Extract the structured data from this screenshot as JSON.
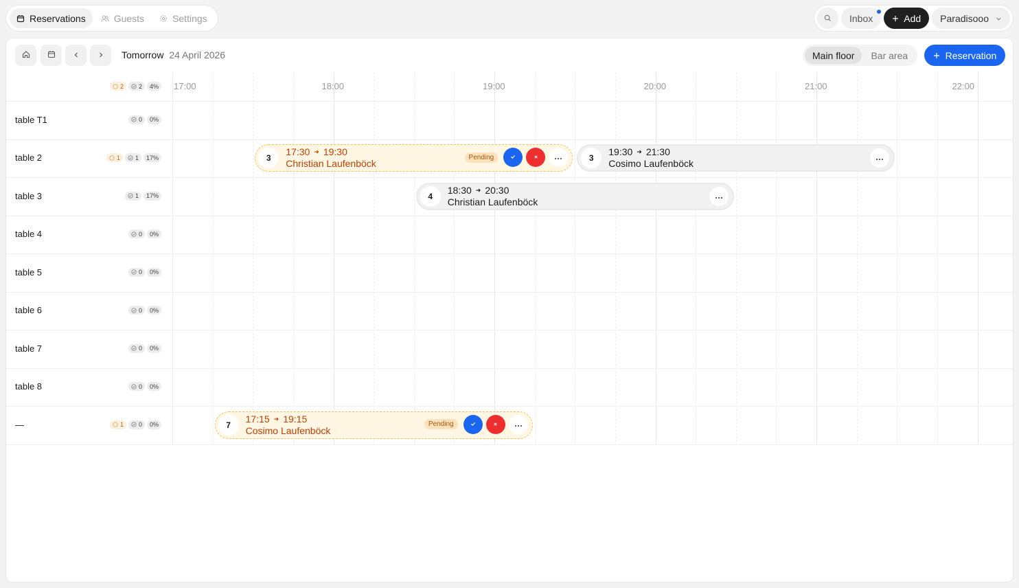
{
  "nav": {
    "tabs": [
      {
        "label": "Reservations",
        "icon": "calendar-icon",
        "active": true
      },
      {
        "label": "Guests",
        "icon": "users-icon",
        "active": false
      },
      {
        "label": "Settings",
        "icon": "gear-icon",
        "active": false
      }
    ]
  },
  "header": {
    "inbox_label": "Inbox",
    "add_label": "Add",
    "venue_label": "Paradisooo"
  },
  "toolbar": {
    "day_label": "Tomorrow",
    "date_label": "24 April 2026",
    "areas": [
      "Main floor",
      "Bar area"
    ],
    "active_area": "Main floor",
    "reservation_label": "Reservation"
  },
  "colors": {
    "accent": "#1a66f0",
    "pending_text": "#c43e00",
    "pending_bg": "#fff6e4",
    "decline": "#ee2e2e"
  },
  "timeline": {
    "hours": [
      "17:00",
      "18:00",
      "19:00",
      "20:00",
      "21:00",
      "22:00"
    ]
  },
  "summary": {
    "pending": "2",
    "confirmed": "2",
    "percent": "4%"
  },
  "tables": [
    {
      "name": "table T1",
      "pending": null,
      "confirmed": "0",
      "percent": "0%"
    },
    {
      "name": "table 2",
      "pending": "1",
      "confirmed": "1",
      "percent": "17%"
    },
    {
      "name": "table 3",
      "pending": null,
      "confirmed": "1",
      "percent": "17%"
    },
    {
      "name": "table 4",
      "pending": null,
      "confirmed": "0",
      "percent": "0%"
    },
    {
      "name": "table 5",
      "pending": null,
      "confirmed": "0",
      "percent": "0%"
    },
    {
      "name": "table 6",
      "pending": null,
      "confirmed": "0",
      "percent": "0%"
    },
    {
      "name": "table 7",
      "pending": null,
      "confirmed": "0",
      "percent": "0%"
    },
    {
      "name": "table 8",
      "pending": null,
      "confirmed": "0",
      "percent": "0%"
    },
    {
      "name": "—",
      "pending": "1",
      "confirmed": "0",
      "percent": "0%"
    }
  ],
  "reservations": [
    {
      "row": 1,
      "party": "3",
      "start": "17:30",
      "end": "19:30",
      "guest": "Christian Laufenböck",
      "status": "pending",
      "status_label": "Pending"
    },
    {
      "row": 1,
      "party": "3",
      "start": "19:30",
      "end": "21:30",
      "guest": "Cosimo Laufenböck",
      "status": "confirmed"
    },
    {
      "row": 2,
      "party": "4",
      "start": "18:30",
      "end": "20:30",
      "guest": "Christian Laufenböck",
      "status": "confirmed"
    },
    {
      "row": 8,
      "party": "7",
      "start": "17:15",
      "end": "19:15",
      "guest": "Cosimo Laufenböck",
      "status": "pending",
      "status_label": "Pending"
    }
  ]
}
